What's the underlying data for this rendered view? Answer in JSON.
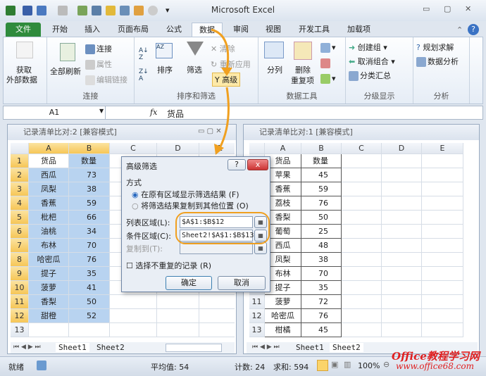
{
  "app": {
    "title": "Microsoft Excel",
    "accent": "#2f8b3c"
  },
  "tabs": [
    {
      "label": "文件"
    },
    {
      "label": "开始"
    },
    {
      "label": "插入"
    },
    {
      "label": "页面布局"
    },
    {
      "label": "公式"
    },
    {
      "label": "数据"
    },
    {
      "label": "审阅"
    },
    {
      "label": "视图"
    },
    {
      "label": "开发工具"
    },
    {
      "label": "加载项"
    }
  ],
  "ribbon": {
    "get_external": "获取\n外部数据",
    "get_external_a": "获取",
    "get_external_b": "外部数据",
    "refresh_all": "全部刷新",
    "connections": "连接",
    "properties": "属性",
    "edit_links": "编辑链接",
    "group_connections": "连接",
    "sort": "排序",
    "filter": "筛选",
    "clear": "清除",
    "reapply": "重新应用",
    "advanced": "高级",
    "group_sort": "排序和筛选",
    "text_to_columns": "分列",
    "remove_dup_a": "删除",
    "remove_dup_b": "重复项",
    "group_tools": "数据工具",
    "group": "创建组",
    "ungroup": "取消组合",
    "subtotal": "分类汇总",
    "group_outline": "分级显示",
    "solver": "规划求解",
    "data_analysis": "数据分析",
    "group_analysis": "分析"
  },
  "formula_bar": {
    "name_box": "A1",
    "fx": "fx",
    "value": "货品"
  },
  "left_window": {
    "title": "记录清单比对:2  [兼容模式]",
    "columns": [
      "A",
      "B",
      "C",
      "D",
      "E"
    ],
    "rows": [
      [
        "货品",
        "数量"
      ],
      [
        "西瓜",
        "73"
      ],
      [
        "凤梨",
        "38"
      ],
      [
        "香蕉",
        "59"
      ],
      [
        "枇杷",
        "66"
      ],
      [
        "油桃",
        "34"
      ],
      [
        "布林",
        "70"
      ],
      [
        "哈密瓜",
        "76"
      ],
      [
        "提子",
        "35"
      ],
      [
        "菠萝",
        "41"
      ],
      [
        "香梨",
        "50"
      ],
      [
        "甜橙",
        "52"
      ],
      [
        "",
        ""
      ]
    ],
    "sheets": [
      "Sheet1",
      "Sheet2"
    ],
    "active_sheet": "Sheet1"
  },
  "right_window": {
    "title": "记录清单比对:1  [兼容模式]",
    "columns": [
      "A",
      "B",
      "C",
      "D",
      "E"
    ],
    "rows": [
      [
        "货品",
        "数量"
      ],
      [
        "苹果",
        "45"
      ],
      [
        "香蕉",
        "59"
      ],
      [
        "荔枝",
        "76"
      ],
      [
        "香梨",
        "50"
      ],
      [
        "葡萄",
        "25"
      ],
      [
        "西瓜",
        "48"
      ],
      [
        "凤梨",
        "38"
      ],
      [
        "布林",
        "70"
      ],
      [
        "提子",
        "35"
      ],
      [
        "菠萝",
        "72"
      ],
      [
        "哈密瓜",
        "76"
      ],
      [
        "柑橘",
        "45"
      ]
    ],
    "sheets": [
      "Sheet1",
      "Sheet2"
    ],
    "active_sheet": "Sheet2"
  },
  "dialog": {
    "title": "高级筛选",
    "help": "?",
    "close": "x",
    "section": "方式",
    "option1": "在原有区域显示筛选结果 (F)",
    "option2": "将筛选结果复制到其他位置 (O)",
    "selected_option": 1,
    "list_label": "列表区域(L):",
    "list_value": "$A$1:$B$12",
    "criteria_label": "条件区域(C):",
    "criteria_value": "Sheet2!$A$1:$B$13",
    "copy_label": "复制到(T):",
    "copy_value": "",
    "unique_label": "选择不重复的记录 (R)",
    "unique_checked": false,
    "ok": "确定",
    "cancel": "取消"
  },
  "status": {
    "ready": "就绪",
    "average": "平均值: 54",
    "count": "计数: 24",
    "sum": "求和: 594",
    "zoom": "100%"
  },
  "watermark": {
    "line1": "Office教程学习网",
    "line2": "www.office68.com"
  }
}
